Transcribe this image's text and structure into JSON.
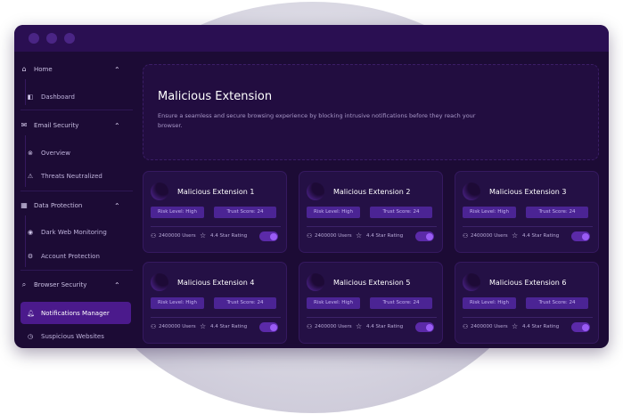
{
  "sidebar": {
    "groups": [
      {
        "label": "Home",
        "icon": "home-icon",
        "items": [
          {
            "label": "Dashboard",
            "icon": "dashboard-icon"
          }
        ]
      },
      {
        "label": "Email Security",
        "icon": "mail-icon",
        "items": [
          {
            "label": "Overview",
            "icon": "overview-icon"
          },
          {
            "label": "Threats Neutralized",
            "icon": "warning-icon"
          }
        ]
      },
      {
        "label": "Data Protection",
        "icon": "grid-icon",
        "items": [
          {
            "label": "Dark Web Monitoring",
            "icon": "location-icon"
          },
          {
            "label": "Account Protection",
            "icon": "gear-icon"
          }
        ]
      },
      {
        "label": "Browser Security",
        "icon": "search-icon",
        "items": [
          {
            "label": "Notifications Manager",
            "icon": "bell-icon"
          },
          {
            "label": "Suspicious Websites",
            "icon": "clock-icon"
          }
        ]
      }
    ],
    "active_item": "Notifications Manager"
  },
  "hero": {
    "title": "Malicious Extension",
    "description": "Ensure a seamless and secure browsing experience by blocking intrusive notifications before they reach your browser."
  },
  "cards": [
    {
      "title": "Malicious Extension 1",
      "risk": "Risk Level: High",
      "trust": "Trust Score: 24",
      "users": "2400000 Users",
      "rating": "4.4 Star Rating",
      "enabled": true
    },
    {
      "title": "Malicious Extension 2",
      "risk": "Risk Level: High",
      "trust": "Trust Score: 24",
      "users": "2400000 Users",
      "rating": "4.4 Star Rating",
      "enabled": true
    },
    {
      "title": "Malicious Extension 3",
      "risk": "Risk Level: High",
      "trust": "Trust Score: 24",
      "users": "2400000 Users",
      "rating": "4.4 Star Rating",
      "enabled": true
    },
    {
      "title": "Malicious Extension 4",
      "risk": "Risk Level: High",
      "trust": "Trust Score: 24",
      "users": "2400000 Users",
      "rating": "4.4 Star Rating",
      "enabled": true
    },
    {
      "title": "Malicious Extension 5",
      "risk": "Risk Level: High",
      "trust": "Trust Score: 24",
      "users": "2400000 Users",
      "rating": "4.4 Star Rating",
      "enabled": true
    },
    {
      "title": "Malicious Extension 6",
      "risk": "Risk Level: High",
      "trust": "Trust Score: 24",
      "users": "2400000 Users",
      "rating": "4.4 Star Rating",
      "enabled": true
    }
  ],
  "colors": {
    "background": "#1c0b35",
    "accent": "#9a5cf5",
    "active_nav": "#4b1a8c",
    "badge": "#4b2494"
  }
}
